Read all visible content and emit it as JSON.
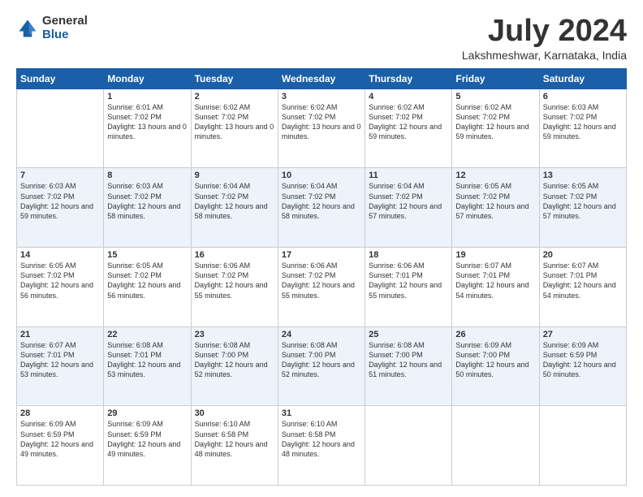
{
  "header": {
    "logo_general": "General",
    "logo_blue": "Blue",
    "month_title": "July 2024",
    "location": "Lakshmeshwar, Karnataka, India"
  },
  "weekdays": [
    "Sunday",
    "Monday",
    "Tuesday",
    "Wednesday",
    "Thursday",
    "Friday",
    "Saturday"
  ],
  "weeks": [
    [
      {
        "day": "",
        "sunrise": "",
        "sunset": "",
        "daylight": ""
      },
      {
        "day": "1",
        "sunrise": "Sunrise: 6:01 AM",
        "sunset": "Sunset: 7:02 PM",
        "daylight": "Daylight: 13 hours and 0 minutes."
      },
      {
        "day": "2",
        "sunrise": "Sunrise: 6:02 AM",
        "sunset": "Sunset: 7:02 PM",
        "daylight": "Daylight: 13 hours and 0 minutes."
      },
      {
        "day": "3",
        "sunrise": "Sunrise: 6:02 AM",
        "sunset": "Sunset: 7:02 PM",
        "daylight": "Daylight: 13 hours and 0 minutes."
      },
      {
        "day": "4",
        "sunrise": "Sunrise: 6:02 AM",
        "sunset": "Sunset: 7:02 PM",
        "daylight": "Daylight: 12 hours and 59 minutes."
      },
      {
        "day": "5",
        "sunrise": "Sunrise: 6:02 AM",
        "sunset": "Sunset: 7:02 PM",
        "daylight": "Daylight: 12 hours and 59 minutes."
      },
      {
        "day": "6",
        "sunrise": "Sunrise: 6:03 AM",
        "sunset": "Sunset: 7:02 PM",
        "daylight": "Daylight: 12 hours and 59 minutes."
      }
    ],
    [
      {
        "day": "7",
        "sunrise": "Sunrise: 6:03 AM",
        "sunset": "Sunset: 7:02 PM",
        "daylight": "Daylight: 12 hours and 59 minutes."
      },
      {
        "day": "8",
        "sunrise": "Sunrise: 6:03 AM",
        "sunset": "Sunset: 7:02 PM",
        "daylight": "Daylight: 12 hours and 58 minutes."
      },
      {
        "day": "9",
        "sunrise": "Sunrise: 6:04 AM",
        "sunset": "Sunset: 7:02 PM",
        "daylight": "Daylight: 12 hours and 58 minutes."
      },
      {
        "day": "10",
        "sunrise": "Sunrise: 6:04 AM",
        "sunset": "Sunset: 7:02 PM",
        "daylight": "Daylight: 12 hours and 58 minutes."
      },
      {
        "day": "11",
        "sunrise": "Sunrise: 6:04 AM",
        "sunset": "Sunset: 7:02 PM",
        "daylight": "Daylight: 12 hours and 57 minutes."
      },
      {
        "day": "12",
        "sunrise": "Sunrise: 6:05 AM",
        "sunset": "Sunset: 7:02 PM",
        "daylight": "Daylight: 12 hours and 57 minutes."
      },
      {
        "day": "13",
        "sunrise": "Sunrise: 6:05 AM",
        "sunset": "Sunset: 7:02 PM",
        "daylight": "Daylight: 12 hours and 57 minutes."
      }
    ],
    [
      {
        "day": "14",
        "sunrise": "Sunrise: 6:05 AM",
        "sunset": "Sunset: 7:02 PM",
        "daylight": "Daylight: 12 hours and 56 minutes."
      },
      {
        "day": "15",
        "sunrise": "Sunrise: 6:05 AM",
        "sunset": "Sunset: 7:02 PM",
        "daylight": "Daylight: 12 hours and 56 minutes."
      },
      {
        "day": "16",
        "sunrise": "Sunrise: 6:06 AM",
        "sunset": "Sunset: 7:02 PM",
        "daylight": "Daylight: 12 hours and 55 minutes."
      },
      {
        "day": "17",
        "sunrise": "Sunrise: 6:06 AM",
        "sunset": "Sunset: 7:02 PM",
        "daylight": "Daylight: 12 hours and 55 minutes."
      },
      {
        "day": "18",
        "sunrise": "Sunrise: 6:06 AM",
        "sunset": "Sunset: 7:01 PM",
        "daylight": "Daylight: 12 hours and 55 minutes."
      },
      {
        "day": "19",
        "sunrise": "Sunrise: 6:07 AM",
        "sunset": "Sunset: 7:01 PM",
        "daylight": "Daylight: 12 hours and 54 minutes."
      },
      {
        "day": "20",
        "sunrise": "Sunrise: 6:07 AM",
        "sunset": "Sunset: 7:01 PM",
        "daylight": "Daylight: 12 hours and 54 minutes."
      }
    ],
    [
      {
        "day": "21",
        "sunrise": "Sunrise: 6:07 AM",
        "sunset": "Sunset: 7:01 PM",
        "daylight": "Daylight: 12 hours and 53 minutes."
      },
      {
        "day": "22",
        "sunrise": "Sunrise: 6:08 AM",
        "sunset": "Sunset: 7:01 PM",
        "daylight": "Daylight: 12 hours and 53 minutes."
      },
      {
        "day": "23",
        "sunrise": "Sunrise: 6:08 AM",
        "sunset": "Sunset: 7:00 PM",
        "daylight": "Daylight: 12 hours and 52 minutes."
      },
      {
        "day": "24",
        "sunrise": "Sunrise: 6:08 AM",
        "sunset": "Sunset: 7:00 PM",
        "daylight": "Daylight: 12 hours and 52 minutes."
      },
      {
        "day": "25",
        "sunrise": "Sunrise: 6:08 AM",
        "sunset": "Sunset: 7:00 PM",
        "daylight": "Daylight: 12 hours and 51 minutes."
      },
      {
        "day": "26",
        "sunrise": "Sunrise: 6:09 AM",
        "sunset": "Sunset: 7:00 PM",
        "daylight": "Daylight: 12 hours and 50 minutes."
      },
      {
        "day": "27",
        "sunrise": "Sunrise: 6:09 AM",
        "sunset": "Sunset: 6:59 PM",
        "daylight": "Daylight: 12 hours and 50 minutes."
      }
    ],
    [
      {
        "day": "28",
        "sunrise": "Sunrise: 6:09 AM",
        "sunset": "Sunset: 6:59 PM",
        "daylight": "Daylight: 12 hours and 49 minutes."
      },
      {
        "day": "29",
        "sunrise": "Sunrise: 6:09 AM",
        "sunset": "Sunset: 6:59 PM",
        "daylight": "Daylight: 12 hours and 49 minutes."
      },
      {
        "day": "30",
        "sunrise": "Sunrise: 6:10 AM",
        "sunset": "Sunset: 6:58 PM",
        "daylight": "Daylight: 12 hours and 48 minutes."
      },
      {
        "day": "31",
        "sunrise": "Sunrise: 6:10 AM",
        "sunset": "Sunset: 6:58 PM",
        "daylight": "Daylight: 12 hours and 48 minutes."
      },
      {
        "day": "",
        "sunrise": "",
        "sunset": "",
        "daylight": ""
      },
      {
        "day": "",
        "sunrise": "",
        "sunset": "",
        "daylight": ""
      },
      {
        "day": "",
        "sunrise": "",
        "sunset": "",
        "daylight": ""
      }
    ]
  ]
}
